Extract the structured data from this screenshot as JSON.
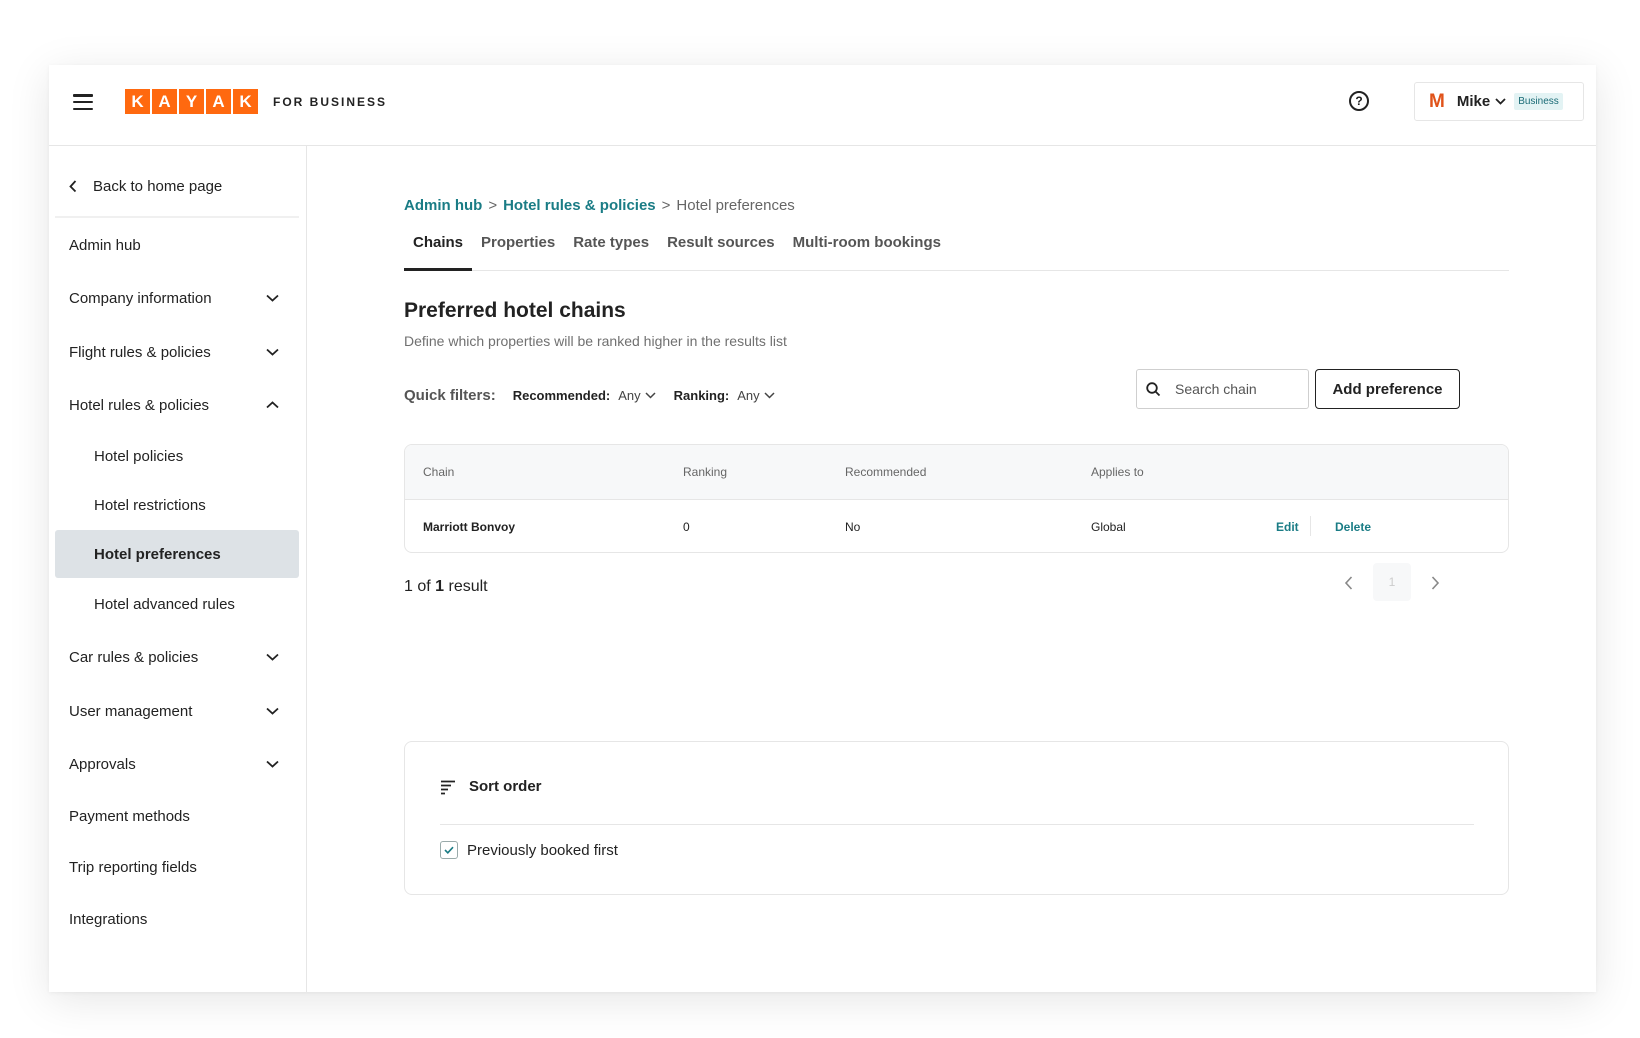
{
  "header": {
    "logo_letters": [
      "K",
      "A",
      "Y",
      "A",
      "K"
    ],
    "logo_subtitle": "FOR BUSINESS",
    "help_icon": "?",
    "user": {
      "avatar_initial": "M",
      "name": "Mike",
      "badge": "Business"
    }
  },
  "sidebar": {
    "back_label": "Back to home page",
    "items": [
      {
        "label": "Admin hub",
        "expandable": false
      },
      {
        "label": "Company information",
        "expandable": true,
        "expanded": false
      },
      {
        "label": "Flight rules & policies",
        "expandable": true,
        "expanded": false
      },
      {
        "label": "Hotel rules & policies",
        "expandable": true,
        "expanded": true
      },
      {
        "label": "Hotel policies",
        "sub": true
      },
      {
        "label": "Hotel restrictions",
        "sub": true
      },
      {
        "label": "Hotel preferences",
        "sub": true,
        "active": true
      },
      {
        "label": "Hotel advanced rules",
        "sub": true
      },
      {
        "label": "Car rules & policies",
        "expandable": true,
        "expanded": false
      },
      {
        "label": "User management",
        "expandable": true,
        "expanded": false
      },
      {
        "label": "Approvals",
        "expandable": true,
        "expanded": false
      },
      {
        "label": "Payment methods",
        "expandable": false
      },
      {
        "label": "Trip reporting fields",
        "expandable": false
      },
      {
        "label": "Integrations",
        "expandable": false
      }
    ]
  },
  "breadcrumb": {
    "items": [
      "Admin hub",
      "Hotel rules & policies"
    ],
    "current": "Hotel preferences",
    "separator": ">"
  },
  "tabs": [
    {
      "label": "Chains",
      "active": true
    },
    {
      "label": "Properties"
    },
    {
      "label": "Rate types"
    },
    {
      "label": "Result sources"
    },
    {
      "label": "Multi-room bookings"
    }
  ],
  "page": {
    "title": "Preferred hotel chains",
    "subtitle": "Define which properties will be ranked higher in the results list"
  },
  "filters": {
    "label": "Quick filters:",
    "recommended": {
      "name": "Recommended:",
      "value": "Any"
    },
    "ranking": {
      "name": "Ranking:",
      "value": "Any"
    }
  },
  "search": {
    "placeholder": "Search chain",
    "value": ""
  },
  "add_button": "Add preference",
  "table": {
    "columns": [
      "Chain",
      "Ranking",
      "Recommended",
      "Applies to"
    ],
    "rows": [
      {
        "chain": "Marriott Bonvoy",
        "ranking": "0",
        "recommended": "No",
        "applies_to": "Global",
        "edit": "Edit",
        "delete": "Delete"
      }
    ]
  },
  "results": {
    "prefix": "1 of",
    "count": "1",
    "suffix": "result"
  },
  "pagination": {
    "current_page": "1"
  },
  "sort": {
    "title": "Sort order",
    "option_label": "Previously booked first",
    "option_checked": true
  },
  "colors": {
    "brand": "#ff690f",
    "link": "#1a7c85",
    "active_nav_bg": "#dde2e6"
  }
}
